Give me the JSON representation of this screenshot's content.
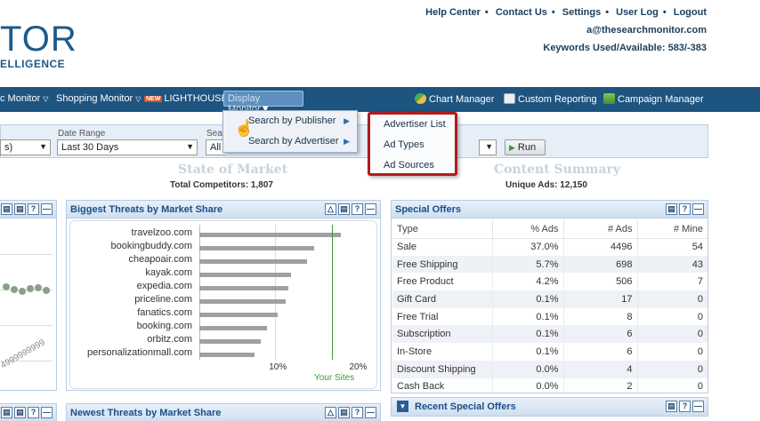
{
  "header": {
    "logo_main": "TOR",
    "logo_sub": "ELLIGENCE",
    "links": [
      "Help Center",
      "Contact Us",
      "Settings",
      "User Log",
      "Logout"
    ],
    "link_sep": "•",
    "email": "a@thesearchmonitor.com",
    "keywords": "Keywords Used/Available: 583/-383"
  },
  "nav": {
    "items": [
      "c Monitor",
      "Shopping Monitor",
      "LIGHTHOUSE",
      "Display Monitor"
    ],
    "new_badge": "NEW",
    "right_items": [
      "Chart Manager",
      "Custom Reporting",
      "Campaign Manager"
    ],
    "chevron": "▽"
  },
  "submenu": {
    "items": [
      "Search by Publisher",
      "Search by Advertiser"
    ],
    "flyout": [
      "Advertiser List",
      "Ad Types",
      "Ad Sources"
    ]
  },
  "filters": {
    "first_value": "s)",
    "date_label": "Date Range",
    "date_value": "Last 30 Days",
    "third_label": "Sea",
    "third_value": "All",
    "run_label": "Run"
  },
  "summary": {
    "left_title": "State of Market",
    "left_sub": "Total Competitors: 1,807",
    "right_title": "Content Summary",
    "right_sub": "Unique Ads: 12,150"
  },
  "threats_panel": {
    "title": "Biggest Threats by Market Share",
    "tools": [
      "△",
      "▤",
      "?",
      "—"
    ]
  },
  "chart_data": {
    "type": "bar",
    "orientation": "horizontal",
    "categories": [
      "travelzoo.com",
      "bookingbuddy.com",
      "cheapoair.com",
      "kayak.com",
      "expedia.com",
      "priceline.com",
      "fanatics.com",
      "booking.com",
      "orbitz.com",
      "personalizationmall.com"
    ],
    "values": [
      17.6,
      14.3,
      13.4,
      11.4,
      11.1,
      10.7,
      9.7,
      8.4,
      7.6,
      6.9
    ],
    "xlim": [
      0,
      20
    ],
    "xticks": [
      "10%",
      "20%"
    ],
    "reference_line": {
      "value": 16.5,
      "label": "Your Sites"
    },
    "grid": true
  },
  "offers_panel": {
    "title": "Special Offers",
    "tools": [
      "▤",
      "?",
      "—"
    ],
    "columns": [
      "Type",
      "% Ads",
      "# Ads",
      "# Mine"
    ],
    "rows": [
      [
        "Sale",
        "37.0%",
        "4496",
        "54"
      ],
      [
        "Free Shipping",
        "5.7%",
        "698",
        "43"
      ],
      [
        "Free Product",
        "4.2%",
        "506",
        "7"
      ],
      [
        "Gift Card",
        "0.1%",
        "17",
        "0"
      ],
      [
        "Free Trial",
        "0.1%",
        "8",
        "0"
      ],
      [
        "Subscription",
        "0.1%",
        "6",
        "0"
      ],
      [
        "In-Store",
        "0.1%",
        "6",
        "0"
      ],
      [
        "Discount Shipping",
        "0.0%",
        "4",
        "0"
      ],
      [
        "Cash Back",
        "0.0%",
        "2",
        "0"
      ]
    ]
  },
  "recent_offers": {
    "title": "Recent Special Offers",
    "tools": [
      "▤",
      "?",
      "—"
    ]
  },
  "newest_threats": {
    "title": "Newest Threats by Market Share",
    "tools": [
      "△",
      "▤",
      "?",
      "—"
    ]
  },
  "left_stub": {
    "tools": [
      "▤",
      "▤",
      "?",
      "—"
    ],
    "axis_text": "4999999999"
  }
}
